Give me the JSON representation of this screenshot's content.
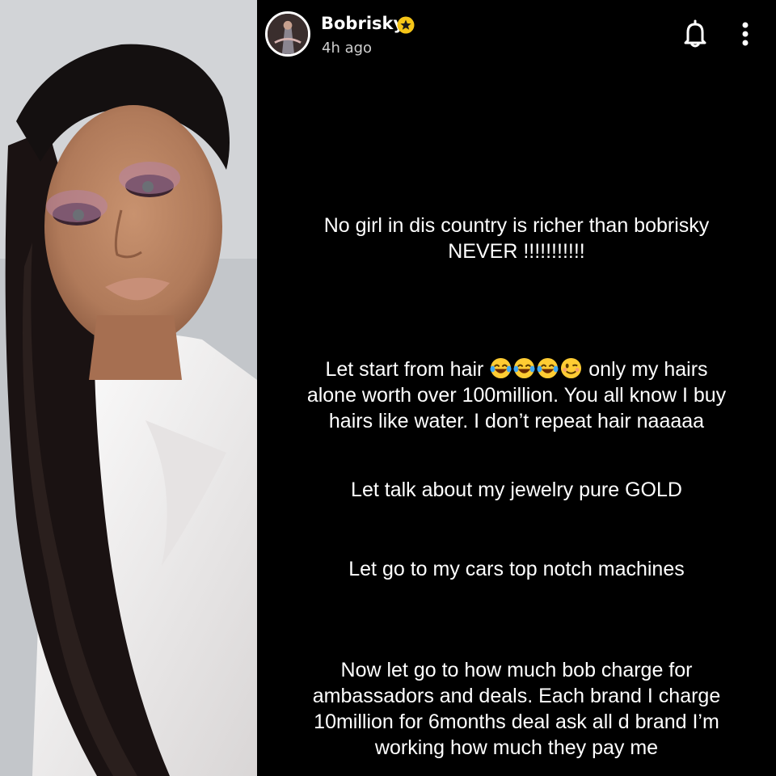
{
  "story": {
    "user_name": "Bobrisky",
    "time_ago": "4h ago",
    "paragraph_1_line_1": "No girl in dis country is richer than bobrisky",
    "paragraph_1_line_2": "NEVER !!!!!!!!!!!",
    "paragraph_2_start": "Let start from hair",
    "paragraph_2_emojis": [
      "laughing-tears-emoji",
      "laughing-tears-emoji",
      "laughing-tears-emoji",
      "winking-emoji"
    ],
    "paragraph_2_rest_line_1": "only my hairs",
    "paragraph_2_line_2": "alone worth over 100million. You all know I buy",
    "paragraph_2_line_3": "hairs like water. I don’t repeat hair naaaaa",
    "paragraph_3": "Let talk about my jewelry pure GOLD",
    "paragraph_4": "Let go to my cars top notch machines",
    "paragraph_5_line_1": "Now let go to how much bob charge for",
    "paragraph_5_line_2": "ambassadors and deals. Each brand I charge",
    "paragraph_5_line_3": "10million for 6months deal ask all d brand I’m",
    "paragraph_5_line_4": "working how much they pay me"
  },
  "colors": {
    "story_background": "#000000",
    "text": "#ffffff",
    "verified_badge": "#f5c518"
  },
  "icons": {
    "verified": "verified-star-icon",
    "notification": "bell-icon",
    "menu": "more-vertical-icon"
  }
}
